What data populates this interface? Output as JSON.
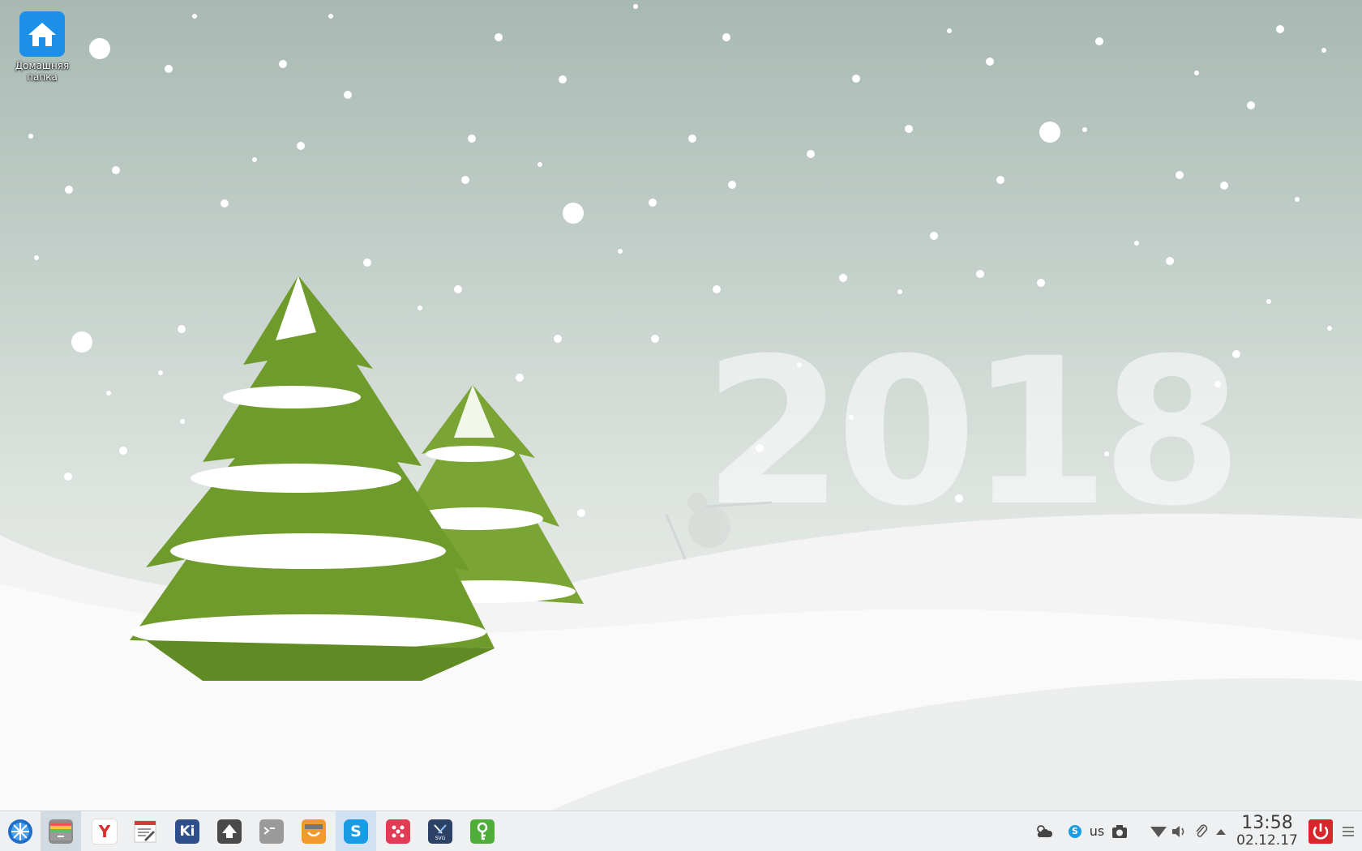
{
  "desktop": {
    "icons": [
      {
        "label": "Домашняя папка",
        "icon": "home-folder-icon"
      }
    ],
    "wallpaper": {
      "year_text": "2018",
      "theme": "snowy hills with fir trees"
    }
  },
  "taskbar": {
    "launcher_icon": "app-launcher-icon",
    "apps": [
      {
        "name": "file-manager",
        "icon": "file-manager-icon",
        "active": true
      },
      {
        "name": "yandex-browser",
        "icon": "yandex-browser-icon",
        "letter": "Y"
      },
      {
        "name": "text-editor",
        "icon": "text-editor-icon"
      },
      {
        "name": "kiten",
        "icon": "kiten-icon",
        "letter": "Ki"
      },
      {
        "name": "inkscape",
        "icon": "inkscape-icon"
      },
      {
        "name": "terminal",
        "icon": "terminal-icon"
      },
      {
        "name": "software-store",
        "icon": "store-icon"
      },
      {
        "name": "skype",
        "icon": "skype-icon",
        "hovered": true
      },
      {
        "name": "dots-app",
        "icon": "dice-icon"
      },
      {
        "name": "svg-editor",
        "icon": "svg-editor-icon"
      },
      {
        "name": "keepass",
        "icon": "keepass-icon"
      }
    ],
    "tray": {
      "keyboard_layout": "us",
      "icons": [
        "weather-icon",
        "skype-tray-icon",
        "screenshot-icon",
        "wifi-icon",
        "volume-icon",
        "clipboard-icon",
        "expand-arrow-icon",
        "power-icon",
        "menu-icon"
      ]
    },
    "clock": {
      "time": "13:58",
      "date": "02.12.17"
    }
  },
  "colors": {
    "taskbar_bg": "#eef0f1",
    "accent_blue": "#1e8fe6",
    "power_red": "#d8262b",
    "tree_green": "#6f9a2c"
  }
}
